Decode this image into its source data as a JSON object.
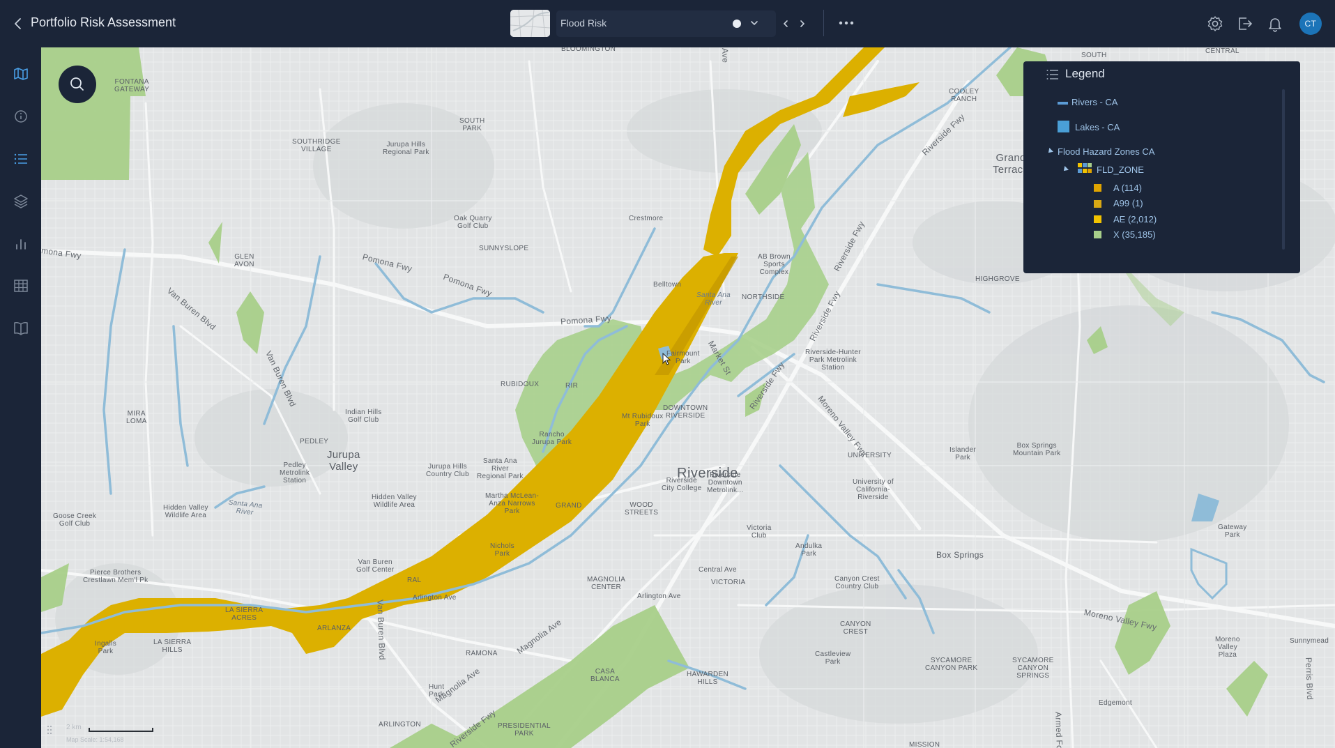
{
  "header": {
    "title": "Portfolio Risk Assessment",
    "map_name": "Flood Risk",
    "user_initials": "CT"
  },
  "legend": {
    "title": "Legend",
    "layers": [
      {
        "label": "Rivers - CA",
        "color": "#5b9bd5"
      },
      {
        "label": "Lakes - CA",
        "color": "#4a9fd6"
      }
    ],
    "group": "Flood Hazard Zones CA",
    "field": "FLD_ZONE",
    "classes": [
      {
        "label": "A (114)",
        "color": "#e0a400"
      },
      {
        "label": "A99 (1)",
        "color": "#d8a814"
      },
      {
        "label": "AE (2,012)",
        "color": "#f2c300"
      },
      {
        "label": "X (35,185)",
        "color": "#a8cf8a"
      }
    ]
  },
  "scale": {
    "distance": "2 km",
    "map_scale": "Map Scale: 1:54,168"
  },
  "places": [
    {
      "text": "BLOOMINGTON"
    },
    {
      "text": "SOUTH"
    },
    {
      "text": "CENTRAL"
    },
    {
      "text": "FONTANA\nGATEWAY"
    },
    {
      "text": "COOLEY\nRANCH"
    },
    {
      "text": "SOUTH\nPARK"
    },
    {
      "text": "SOUTHRIDGE\nVILLAGE"
    },
    {
      "text": "Jurupa Hills\nRegional Park"
    },
    {
      "text": "Grand\nTerrace"
    },
    {
      "text": "Oak Quarry\nGolf Club"
    },
    {
      "text": "Crestmore"
    },
    {
      "text": "SUNNYSLOPE"
    },
    {
      "text": "GLEN\nAVON"
    },
    {
      "text": "Belltown"
    },
    {
      "text": "AB Brown\nSports\nComplex"
    },
    {
      "text": "HIGHGROVE"
    },
    {
      "text": "NORTHSIDE"
    },
    {
      "text": "Riverside-Hunter\nPark Metrolink\nStation"
    },
    {
      "text": "Fairmount\nPark"
    },
    {
      "text": "RUBIDOUX"
    },
    {
      "text": "RIR"
    },
    {
      "text": "MIRA\nLOMA"
    },
    {
      "text": "Indian Hills\nGolf Club"
    },
    {
      "text": "DOWNTOWN\nRIVERSIDE"
    },
    {
      "text": "Mt Rubidoux\nPark"
    },
    {
      "text": "Rancho\nJurupa Park"
    },
    {
      "text": "PEDLEY"
    },
    {
      "text": "Pedley\nMetrolink\nStation"
    },
    {
      "text": "UNIVERSITY"
    },
    {
      "text": "Islander\nPark"
    },
    {
      "text": "Box Springs\nMountain Park"
    },
    {
      "text": "Jurupa Hills\nCountry Club"
    },
    {
      "text": "Santa Ana\nRiver\nRegional Park"
    },
    {
      "text": "Riverside\nDowntown\nMetrolink..."
    },
    {
      "text": "University of\nCalifornia-\nRiverside"
    },
    {
      "text": "Goose Creek\nGolf Club"
    },
    {
      "text": "Hidden Valley\nWildlife Area"
    },
    {
      "text": "Hidden Valley\nWildlife Area"
    },
    {
      "text": "Martha McLean-\nAnza Narrows\nPark"
    },
    {
      "text": "GRAND"
    },
    {
      "text": "WOOD\nSTREETS"
    },
    {
      "text": "Riverside\nCity College"
    },
    {
      "text": "Victoria\nClub"
    },
    {
      "text": "Gateway\nPark"
    },
    {
      "text": "Nichols\nPark"
    },
    {
      "text": "Andulka\nPark"
    },
    {
      "text": "Box Springs"
    },
    {
      "text": "Van Buren\nGolf Center"
    },
    {
      "text": "Pierce Brothers\nCrestlawn Mem'l Pk"
    },
    {
      "text": "RAL"
    },
    {
      "text": "MAGNOLIA\nCENTER"
    },
    {
      "text": "Central Ave"
    },
    {
      "text": "VICTORIA"
    },
    {
      "text": "Canyon Crest\nCountry Club"
    },
    {
      "text": "LA SIERRA\nACRES"
    },
    {
      "text": "ARLANZA"
    },
    {
      "text": "Arlington Ave"
    },
    {
      "text": "Arlington Ave"
    },
    {
      "text": "CANYON\nCREST"
    },
    {
      "text": "Moreno\nValley\nPlaza"
    },
    {
      "text": "Sunnymead"
    },
    {
      "text": "Ingalls\nPark"
    },
    {
      "text": "LA SIERRA\nHILLS"
    },
    {
      "text": "RAMONA"
    },
    {
      "text": "CASA\nBLANCA"
    },
    {
      "text": "HAWARDEN\nHILLS"
    },
    {
      "text": "Castleview\nPark"
    },
    {
      "text": "SYCAMORE\nCANYON PARK"
    },
    {
      "text": "SYCAMORE\nCANYON\nSPRINGS"
    },
    {
      "text": "Hunt\nPark"
    },
    {
      "text": "Edgemont"
    },
    {
      "text": "ARLINGTON"
    },
    {
      "text": "PRESIDENTIAL\nPARK"
    },
    {
      "text": "MISSION"
    }
  ],
  "big_places": [
    {
      "text": "Riverside"
    },
    {
      "text": "Jurupa\nValley"
    }
  ],
  "roads": [
    {
      "text": "Pomona Fwy"
    },
    {
      "text": "Pomona Fwy"
    },
    {
      "text": "Pomona Fwy"
    },
    {
      "text": "mona Fwy"
    },
    {
      "text": "Riverside Fwy"
    },
    {
      "text": "Riverside Fwy"
    },
    {
      "text": "Riverside Fwy"
    },
    {
      "text": "Riverside Fwy"
    },
    {
      "text": "Moreno Valley Fwy"
    },
    {
      "text": "Moreno Valley Fwy"
    },
    {
      "text": "Van Buren Blvd"
    },
    {
      "text": "Van Buren Blvd"
    },
    {
      "text": "Van Buren Blvd"
    },
    {
      "text": "Magnolia Ave"
    },
    {
      "text": "Magnolia Ave"
    },
    {
      "text": "Market St"
    },
    {
      "text": "Armed Fo"
    },
    {
      "text": "Perris Blvd"
    },
    {
      "text": "Riverside Fwy"
    },
    {
      "text": "Ave"
    }
  ],
  "water_labels": [
    {
      "text": "Santa Ana\nRiver"
    },
    {
      "text": "Santa Ana\nRiver"
    }
  ],
  "colors": {
    "chrome": "#1b2538",
    "map_bg": "#e3e5e6",
    "zone_x": "#a8cf8a",
    "zone_ae": "#dcb000",
    "river": "#8fbcd8"
  }
}
